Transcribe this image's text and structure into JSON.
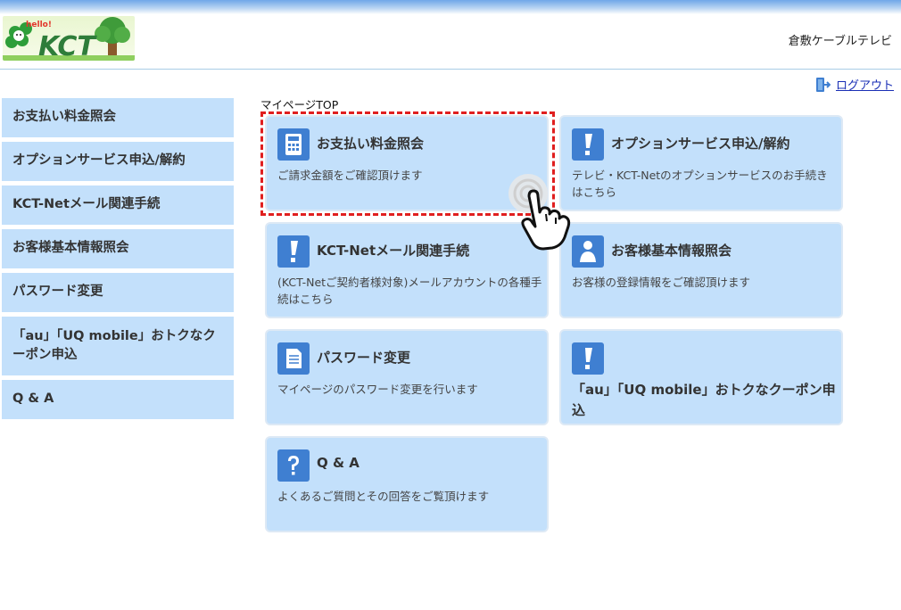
{
  "header": {
    "logo_text": "KCT",
    "logo_tagline": "hello!",
    "company_name": "倉敷ケーブルテレビ"
  },
  "logout": {
    "label": "ログアウト",
    "icon": "logout-icon"
  },
  "breadcrumb": "マイページTOP",
  "sidebar": {
    "items": [
      {
        "label": "お支払い料金照会"
      },
      {
        "label": "オプションサービス申込/解約"
      },
      {
        "label": "KCT-Netメール関連手続"
      },
      {
        "label": "お客様基本情報照会"
      },
      {
        "label": "パスワード変更"
      },
      {
        "label": "「au」「UQ mobile」おトクなクーポン申込"
      },
      {
        "label": "Q & A"
      }
    ]
  },
  "cards": [
    {
      "title": "お支払い料金照会",
      "desc": "ご請求金額をご確認頂けます",
      "icon": "calculator-icon"
    },
    {
      "title": "オプションサービス申込/解約",
      "desc": "テレビ・KCT-Netのオプションサービスのお手続きはこちら",
      "icon": "exclamation-icon"
    },
    {
      "title": "KCT-Netメール関連手続",
      "desc": "(KCT-Netご契約者様対象)メールアカウントの各種手続はこちら",
      "icon": "exclamation-icon"
    },
    {
      "title": "お客様基本情報照会",
      "desc": "お客様の登録情報をご確認頂けます",
      "icon": "person-icon"
    },
    {
      "title": "パスワード変更",
      "desc": "マイページのパスワード変更を行います",
      "icon": "document-icon"
    },
    {
      "title": "「au」「UQ mobile」おトクなクーポン申込",
      "icon": "exclamation-icon"
    },
    {
      "title": "Q & A",
      "desc": "よくあるご質問とその回答をご覧頂けます",
      "icon": "question-icon"
    }
  ],
  "colors": {
    "accent_blue": "#3f7fd1",
    "card_bg": "#c3e0fb",
    "highlight": "#e01f1f",
    "link": "#1a2fb5"
  }
}
